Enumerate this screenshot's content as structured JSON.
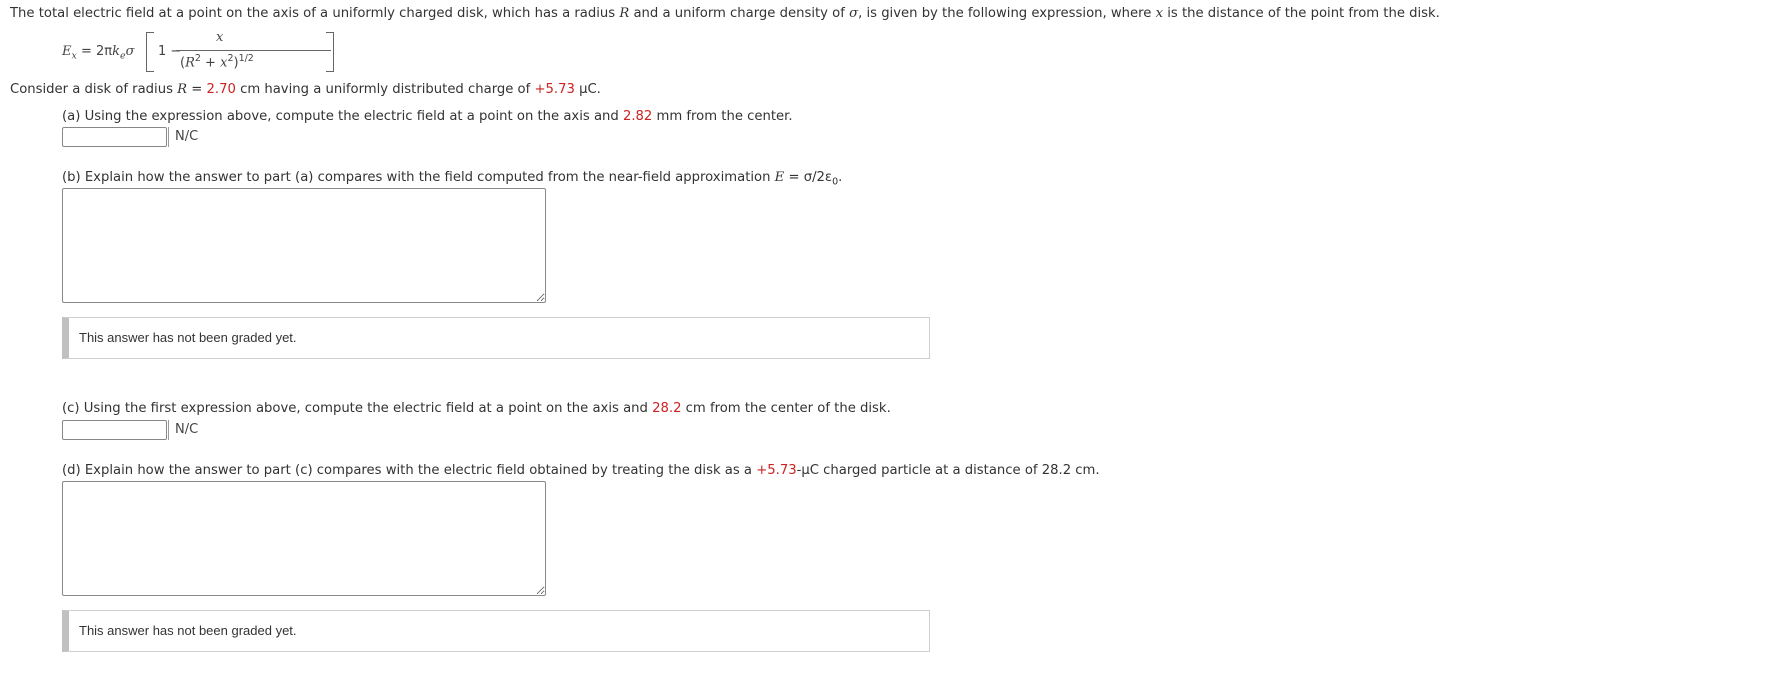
{
  "intro": {
    "before_R": "The total electric field at a point on the axis of a uniformly charged disk, which has a radius ",
    "R": "R",
    "mid": " and a uniform charge density of ",
    "sigma": "σ",
    "after_sigma": ", is given by the following expression, where ",
    "x": "x",
    "end": " is the distance of the point from the disk."
  },
  "formula": {
    "E": "E",
    "sub_x": "x",
    "eq": " = 2π",
    "k": "k",
    "sub_e": "e",
    "sigma": "σ",
    "one": "1 −",
    "numerator": "x",
    "den_open": "(",
    "den_R": "R",
    "den_sq1": "2",
    "den_plus": " + ",
    "den_x": "x",
    "den_sq2": "2",
    "den_close": ")",
    "den_exp": "1/2"
  },
  "consider": {
    "pre": "Consider a disk of radius ",
    "R": "R",
    "eq": " = ",
    "radius_value": "2.70",
    "radius_unit": " cm having a uniformly distributed charge of ",
    "charge_value": "+5.73",
    "charge_unit": " µC."
  },
  "part_a": {
    "text_pre": "(a) Using the expression above, compute the electric field at a point on the axis and ",
    "distance": "2.82",
    "text_post": " mm from the center.",
    "input_value": "",
    "unit": "N/C"
  },
  "part_b": {
    "text_pre": "(b) Explain how the answer to part (a) compares with the field computed from the near-field approximation ",
    "E": "E",
    "formula_rest": " = σ/2ε",
    "sub0": "0",
    "period": ".",
    "textarea_value": "",
    "graded_note": "This answer has not been graded yet."
  },
  "part_c": {
    "text_pre": "(c) Using the first expression above, compute the electric field at a point on the axis and ",
    "distance": "28.2",
    "text_post": " cm from the center of the disk.",
    "input_value": "",
    "unit": "N/C"
  },
  "part_d": {
    "text_pre": "(d) Explain how the answer to part (c) compares with the electric field obtained by treating the disk as a ",
    "charge": "+5.73",
    "text_post": "-µC charged particle at a distance of 28.2 cm.",
    "textarea_value": "",
    "graded_note": "This answer has not been graded yet."
  },
  "colors": {
    "highlight": "#cc2222",
    "text": "#333333",
    "graded_bar": "#c0c0c0"
  }
}
